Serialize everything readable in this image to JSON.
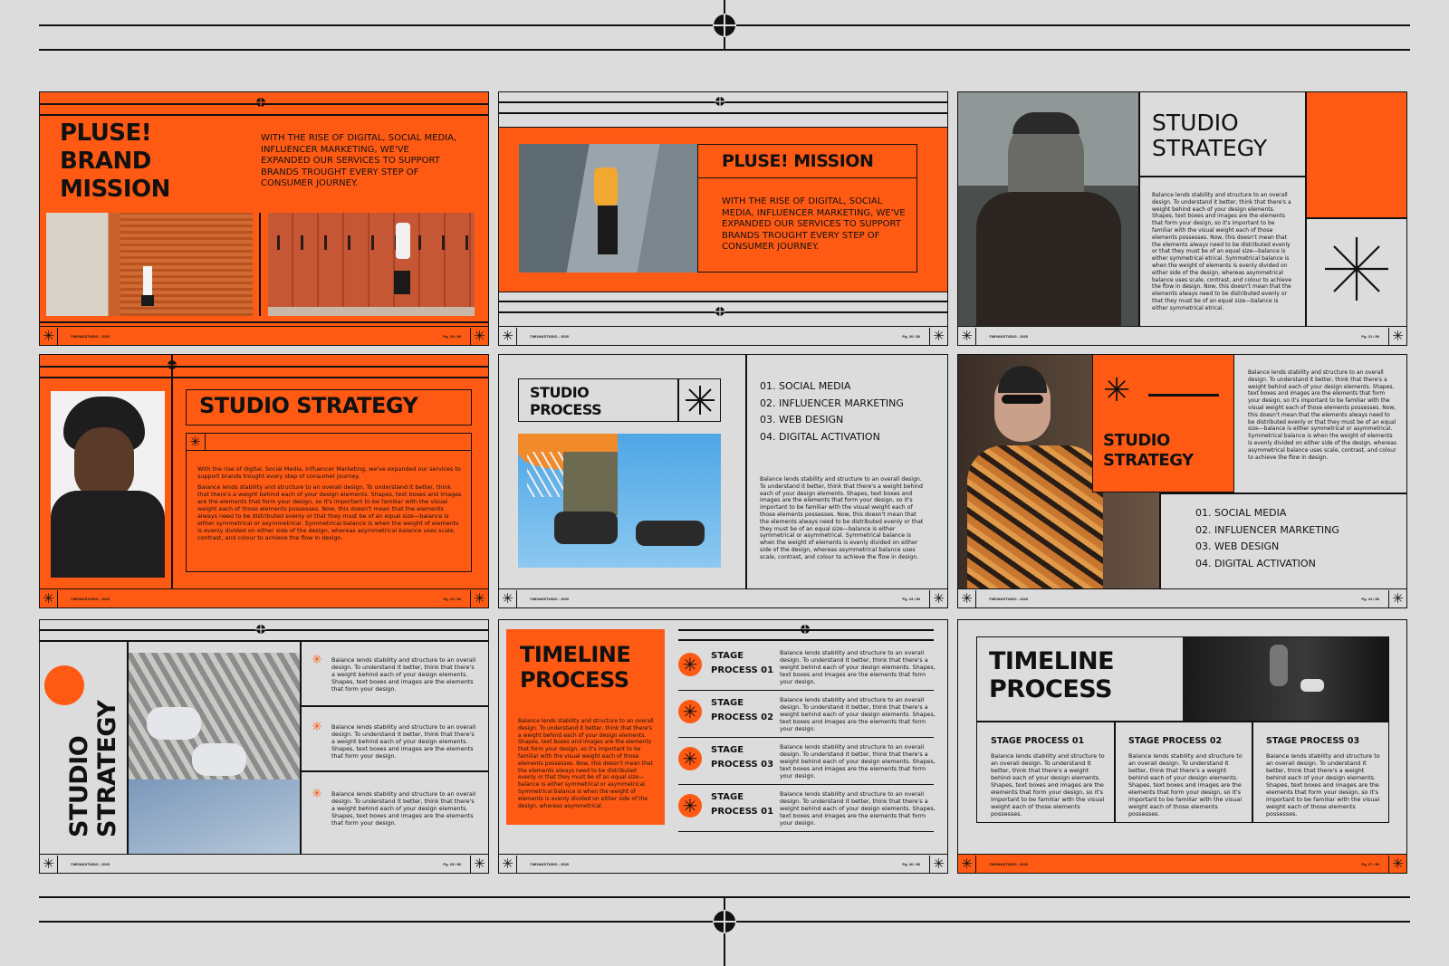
{
  "footer": {
    "brand": "©MIVAKSTUDIO - 2020",
    "page_numbers": [
      "Pg. 19 / 80",
      "Pg. 20 / 80",
      "Pg. 21 / 80",
      "Pg. 22 / 80",
      "Pg. 23 / 80",
      "Pg. 24 / 80",
      "Pg. 25 / 80",
      "Pg. 26 / 80",
      "Pg. 27 / 80"
    ]
  },
  "slide1": {
    "title_line1": "PLUSE!",
    "title_line2": "BRAND",
    "title_line3": "MISSION",
    "body": "WITH THE RISE OF DIGITAL, SOCIAL MEDIA, INFLUENCER MARKETING, WE'VE EXPANDED OUR SERVICES TO SUPPORT BRANDS TROUGHT EVERY STEP OF CONSUMER JOURNEY."
  },
  "slide2": {
    "title": "PLUSE! MISSION",
    "body": "WITH THE RISE OF DIGITAL, SOCIAL MEDIA, INFLUENCER MARKETING, WE'VE EXPANDED OUR SERVICES TO SUPPORT BRANDS TROUGHT EVERY STEP OF CONSUMER JOURNEY."
  },
  "slide3": {
    "title_line1": "STUDIO",
    "title_line2": "STRATEGY",
    "body": "Balance lends stability and structure to an overall design. To understand it better, think that there's a weight behind each of your design elements. Shapes, text boxes and images are the elements that form your design, so it's important to be familiar with the visual weight each of those elements possesses. Now, this doesn't mean that the elements always need to be distributed evenly or that they must be of an equal size—balance is either symmetrical etrical. Symmetrical balance is when the weight of elements is evenly divided on either side of the design, whereas asymmetrical balance uses scale, contrast, and colour to achieve the flow in design. Now, this doesn't mean that the elements always need to be distributed evenly or that they must be of an equal size—balance is either symmetrical etrical."
  },
  "slide4": {
    "title": "STUDIO STRATEGY",
    "intro": "With the rise of digital, Social Media, Influencer Marketing, we've expanded our services to support brands trought every step of consumer journey.",
    "body": "Balance lends stability and structure to an overall design. To understand it better, think that there's a weight behind each of your design elements. Shapes, text boxes and images are the elements that form your design, so it's important to be familiar with the visual weight each of those elements possesses. Now, this doesn't mean that the elements always need to be distributed evenly or that they must be of an equal size—balance is either symmetrical or asymmetrical. Symmetrical balance is when the weight of elements is evenly divided on either side of the design, whereas asymmetrical balance uses scale, contrast, and colour to achieve the flow in design."
  },
  "slide5": {
    "title_line1": "STUDIO",
    "title_line2": "PROCESS",
    "list": [
      "01. SOCIAL MEDIA",
      "02. INFLUENCER MARKETING",
      "03. WEB DESIGN",
      "04. DIGITAL ACTIVATION"
    ],
    "body": "Balance lends stability and structure to an overall design. To understand it better, think that there's a weight behind each of your design elements. Shapes, text boxes and images are the elements that form your design, so it's important to be familiar with the visual weight each of those elements possesses. Now, this doesn't mean that the elements always need to be distributed evenly or that they must be of an equal size—balance is either symmetrical or asymmetrical. Symmetrical balance is when the weight of elements is evenly divided on either side of the design, whereas asymmetrical balance uses scale, contrast, and colour to achieve the flow in design."
  },
  "slide6": {
    "title_line1": "STUDIO",
    "title_line2": "STRATEGY",
    "body": "Balance lends stability and structure to an overall design. To understand it better, think that there's a weight behind each of your design elements. Shapes, text boxes and images are the elements that form your design, so it's important to be familiar with the visual weight each of those elements possesses. Now, this doesn't mean that the elements always need to be distributed evenly or that they must be of an equal size—balance is either symmetrical or asymmetrical. Symmetrical balance is when the weight of elements is evenly divided on either side of the design, whereas asymmetrical balance uses scale, contrast, and colour to achieve the flow in design.",
    "list": [
      "01. SOCIAL MEDIA",
      "02. INFLUENCER MARKETING",
      "03. WEB DESIGN",
      "04. DIGITAL ACTIVATION"
    ]
  },
  "slide7": {
    "title_line1": "STUDIO",
    "title_line2": "STRATEGY",
    "items": [
      "Balance lends stability and structure to an overall design. To understand it better, think that there's a weight behind each of your design elements. Shapes, text boxes and images are the elements that form your design.",
      "Balance lends stability and structure to an overall design. To understand it better, think that there's a weight behind each of your design elements. Shapes, text boxes and images are the elements that form your design.",
      "Balance lends stability and structure to an overall design. To understand it better, think that there's a weight behind each of your design elements. Shapes, text boxes and images are the elements that form your design."
    ]
  },
  "slide8": {
    "title_line1": "TIMELINE",
    "title_line2": "PROCESS",
    "body": "Balance lends stability and structure to an overall design. To understand it better, think that there's a weight behind each of your design elements. Shapes, text boxes and images are the elements that form your design, so it's important to be familiar with the visual weight each of those elements possesses. Now, this doesn't mean that the elements always need to be distributed evenly or that they must be of an equal size—balance is either symmetrical or asymmetrical. Symmetrical balance is when the weight of elements is evenly divided on either side of the design, whereas asymmetrical.",
    "stages": [
      {
        "line1": "STAGE",
        "line2": "PROCESS 01",
        "text": "Balance lends stability and structure to an overall design. To understand it better, think that there's a weight behind each of your design elements. Shapes, text boxes and images are the elements that form your design."
      },
      {
        "line1": "STAGE",
        "line2": "PROCESS 02",
        "text": "Balance lends stability and structure to an overall design. To understand it better, think that there's a weight behind each of your design elements. Shapes, text boxes and images are the elements that form your design."
      },
      {
        "line1": "STAGE",
        "line2": "PROCESS 03",
        "text": "Balance lends stability and structure to an overall design. To understand it better, think that there's a weight behind each of your design elements. Shapes, text boxes and images are the elements that form your design."
      },
      {
        "line1": "STAGE",
        "line2": "PROCESS 01",
        "text": "Balance lends stability and structure to an overall design. To understand it better, think that there's a weight behind each of your design elements. Shapes, text boxes and images are the elements that form your design."
      }
    ]
  },
  "slide9": {
    "title_line1": "TIMELINE",
    "title_line2": "PROCESS",
    "columns": [
      {
        "heading": "STAGE PROCESS 01",
        "text": "Balance lends stability and structure to an overall design. To understand it better, think that there's a weight behind each of your design elements. Shapes, text boxes and images are the elements that form your design, so it's important to be familiar with the visual weight each of those elements possesses."
      },
      {
        "heading": "STAGE PROCESS 02",
        "text": "Balance lends stability and structure to an overall design. To understand it better, think that there's a weight behind each of your design elements. Shapes, text boxes and images are the elements that form your design, so it's important to be familiar with the visual weight each of those elements possesses."
      },
      {
        "heading": "STAGE PROCESS 03",
        "text": "Balance lends stability and structure to an overall design. To understand it better, think that there's a weight behind each of your design elements. Shapes, text boxes and images are the elements that form your design, so it's important to be familiar with the visual weight each of those elements possesses."
      }
    ]
  },
  "colors": {
    "accent": "#ff5a14",
    "background": "#dcdcdc",
    "ink": "#111111"
  },
  "icons": [
    "asterisk-icon",
    "crosshair-icon",
    "starburst-icon"
  ]
}
